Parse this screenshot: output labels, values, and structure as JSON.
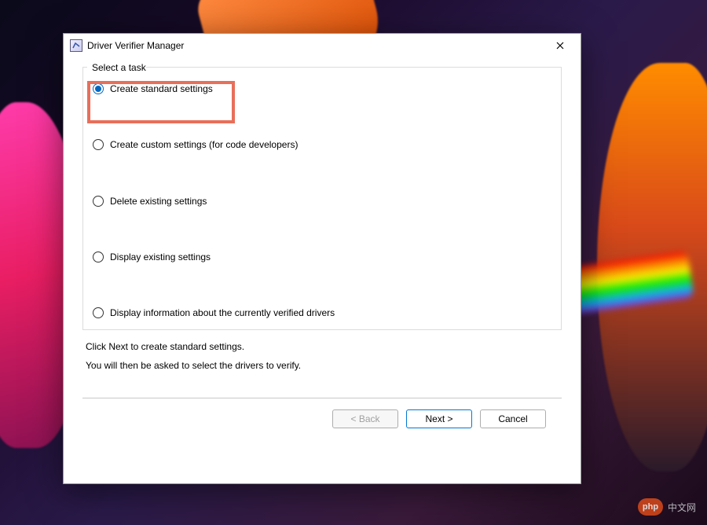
{
  "window": {
    "title": "Driver Verifier Manager"
  },
  "task": {
    "group_label": "Select a task",
    "options": {
      "opt0": "Create standard settings",
      "opt1": "Create custom settings (for code developers)",
      "opt2": "Delete existing settings",
      "opt3": "Display existing settings",
      "opt4": "Display information about the currently verified drivers"
    },
    "selected_index": 0
  },
  "hints": {
    "line1": "Click Next to create standard settings.",
    "line2": "You will then be asked to select the drivers to verify."
  },
  "buttons": {
    "back": "< Back",
    "next": "Next >",
    "cancel": "Cancel"
  },
  "watermark": {
    "logo": "php",
    "text": "中文网"
  }
}
